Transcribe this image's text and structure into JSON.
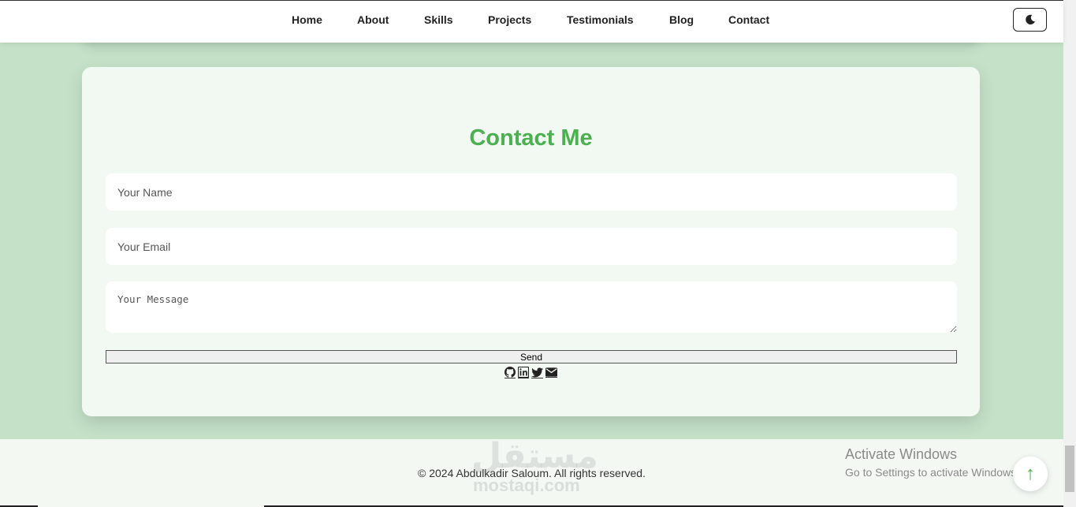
{
  "nav": {
    "items": [
      {
        "label": "Home"
      },
      {
        "label": "About"
      },
      {
        "label": "Skills"
      },
      {
        "label": "Projects"
      },
      {
        "label": "Testimonials"
      },
      {
        "label": "Blog"
      },
      {
        "label": "Contact"
      }
    ],
    "theme_toggle_icon": "moon-icon"
  },
  "contact": {
    "title": "Contact Me",
    "name_placeholder": "Your Name",
    "email_placeholder": "Your Email",
    "message_placeholder": "Your Message",
    "send_label": "Send",
    "social_icons": [
      "github-icon",
      "linkedin-icon",
      "twitter-icon",
      "envelope-icon"
    ]
  },
  "footer": {
    "copyright": "© 2024 Abdulkadir Saloum. All rights reserved."
  },
  "overlay": {
    "watermark_ar": "مستقل",
    "watermark_en": "mostaqi.com",
    "activate_title": "Activate Windows",
    "activate_sub": "Go to Settings to activate Windows.",
    "back_to_top_icon": "arrow-up-icon"
  },
  "colors": {
    "accent": "#4caf50",
    "page_bg": "#c5e2c8",
    "card_bg": "#f2f8f2"
  }
}
